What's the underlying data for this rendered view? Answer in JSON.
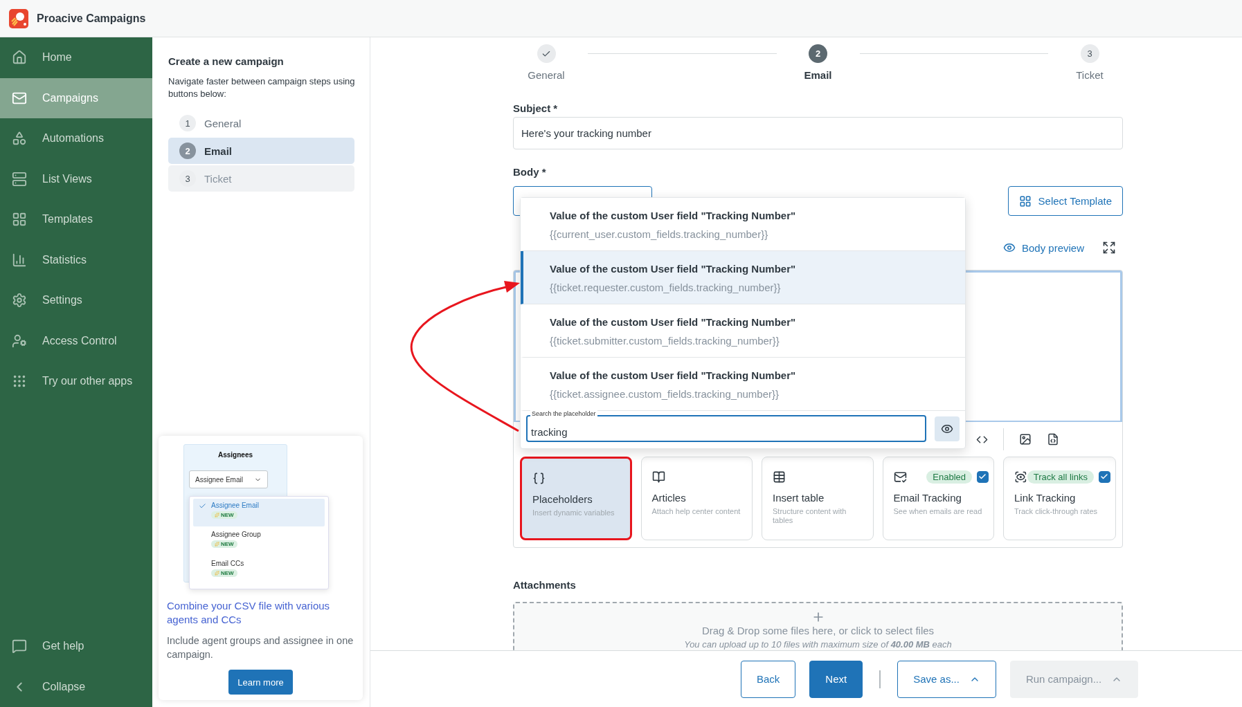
{
  "app": {
    "title": "Proacive Campaigns"
  },
  "nav": {
    "items": [
      {
        "label": "Home",
        "selected": false
      },
      {
        "label": "Campaigns",
        "selected": true
      },
      {
        "label": "Automations",
        "selected": false
      },
      {
        "label": "List Views",
        "selected": false
      },
      {
        "label": "Templates",
        "selected": false
      },
      {
        "label": "Statistics",
        "selected": false
      },
      {
        "label": "Settings",
        "selected": false
      },
      {
        "label": "Access Control",
        "selected": false
      },
      {
        "label": "Try our other apps",
        "selected": false
      }
    ],
    "footer_items": [
      {
        "label": "Get help"
      },
      {
        "label": "Collapse"
      }
    ]
  },
  "steps_panel": {
    "title": "Create a new campaign",
    "hint": "Navigate faster between campaign steps using buttons below:",
    "steps": [
      {
        "number": "1",
        "label": "General",
        "selected": false,
        "disabled": false
      },
      {
        "number": "2",
        "label": "Email",
        "selected": true,
        "disabled": false
      },
      {
        "number": "3",
        "label": "Ticket",
        "selected": false,
        "disabled": true
      }
    ]
  },
  "promo": {
    "illustration": {
      "title": "Assignees",
      "select_value": "Assignee Email",
      "options": [
        {
          "label": "Assignee Email",
          "badge": "NEW",
          "selected": true
        },
        {
          "label": "Assignee Group",
          "badge": "NEW",
          "selected": false
        },
        {
          "label": "Email CCs",
          "badge": "NEW",
          "selected": false
        }
      ]
    },
    "headline": "Combine your CSV file with various agents and CCs",
    "text": "Include agent groups and assignee in one campaign.",
    "button": "Learn more"
  },
  "stepper": [
    {
      "label": "General",
      "done": true,
      "selected": false
    },
    {
      "number": "2",
      "label": "Email",
      "done": false,
      "selected": true
    },
    {
      "number": "3",
      "label": "Ticket",
      "done": false,
      "selected": false
    }
  ],
  "form": {
    "subject": {
      "label": "Subject *",
      "value": "Here's your tracking number"
    },
    "body_label": "Body *",
    "select_template": "Select Template",
    "body_preview": "Body preview"
  },
  "placeholder_popup": {
    "items": [
      {
        "title": "Value of the custom User field \"Tracking Number\"",
        "code": "{{current_user.custom_fields.tracking_number}}",
        "selected": false
      },
      {
        "title": "Value of the custom User field \"Tracking Number\"",
        "code": "{{ticket.requester.custom_fields.tracking_number}}",
        "selected": true
      },
      {
        "title": "Value of the custom User field \"Tracking Number\"",
        "code": "{{ticket.submitter.custom_fields.tracking_number}}",
        "selected": false
      },
      {
        "title": "Value of the custom User field \"Tracking Number\"",
        "code": "{{ticket.assignee.custom_fields.tracking_number}}",
        "selected": false
      }
    ],
    "search": {
      "label": "Search the placeholder",
      "value": "tracking"
    }
  },
  "tools": [
    {
      "kind": "plain",
      "title": "Placeholders",
      "subtitle": "Insert dynamic variables",
      "highlighted": true
    },
    {
      "kind": "plain",
      "title": "Articles",
      "subtitle": "Attach help center content",
      "highlighted": false
    },
    {
      "kind": "plain",
      "title": "Insert table",
      "subtitle": "Structure content with tables",
      "highlighted": false
    },
    {
      "kind": "toggle",
      "title": "Email Tracking",
      "subtitle": "See when emails are read",
      "badge": "Enabled",
      "checked": true,
      "highlighted": false
    },
    {
      "kind": "toggle",
      "title": "Link Tracking",
      "subtitle": "Track click-through rates",
      "badge": "Track all links",
      "checked": true,
      "highlighted": false
    }
  ],
  "attachments": {
    "label": "Attachments",
    "drop_text": "Drag & Drop some files here, or click to select files",
    "limit_text": "You can upload up to 10 files with maximum size of **40.00 MB** each"
  },
  "footer": [
    {
      "kind": "outline",
      "label": "Back",
      "disabled": false
    },
    {
      "kind": "primary",
      "label": "Next",
      "disabled": false
    },
    {
      "kind": "divider"
    },
    {
      "kind": "menu",
      "label": "Save as...",
      "disabled": false
    },
    {
      "kind": "menu",
      "label": "Run campaign...",
      "disabled": true
    }
  ],
  "annotation": {
    "kind": "arrow"
  }
}
